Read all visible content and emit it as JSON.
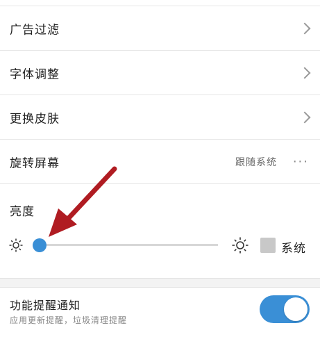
{
  "settings": {
    "items": [
      {
        "label": "广告过滤",
        "icon": "chevron-right-icon"
      },
      {
        "label": "字体调整",
        "icon": "chevron-right-icon"
      },
      {
        "label": "更换皮肤",
        "icon": "chevron-right-icon"
      }
    ],
    "rotate": {
      "label": "旋转屏幕",
      "value": "跟随系统",
      "more": "···"
    }
  },
  "brightness": {
    "label": "亮度",
    "level": 0.0,
    "system_label": "系统",
    "system_checked": false,
    "icons": [
      "sun-icon-low",
      "sun-icon-high"
    ]
  },
  "notification": {
    "title": "功能提醒通知",
    "subtitle": "应用更新提醒，垃圾清理提醒",
    "enabled": true
  },
  "colors": {
    "accent": "#3a8fd6",
    "annotation_arrow": "#b01c22"
  }
}
